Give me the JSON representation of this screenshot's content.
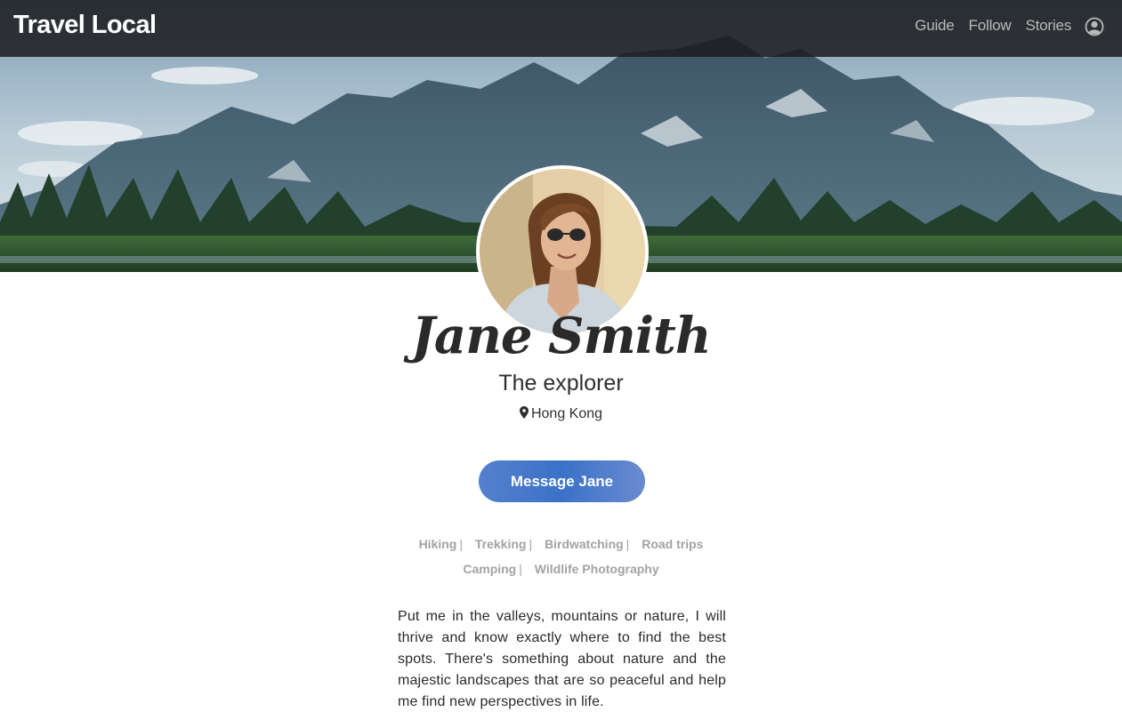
{
  "brand": "Travel Local",
  "nav": {
    "links": [
      "Guide",
      "Follow",
      "Stories"
    ]
  },
  "profile": {
    "name": "Jane Smith",
    "tagline": "The explorer",
    "location": "Hong Kong",
    "message_button": "Message Jane"
  },
  "interests": [
    "Hiking",
    "Trekking",
    "Birdwatching",
    "Road trips",
    "Camping",
    "Wildlife Photography"
  ],
  "bio": "Put me in the valleys, mountains or nature, I will thrive and know exactly where to find the best spots. There's something about nature and the majestic landscapes that are so peaceful and help me find new perspectives in life."
}
